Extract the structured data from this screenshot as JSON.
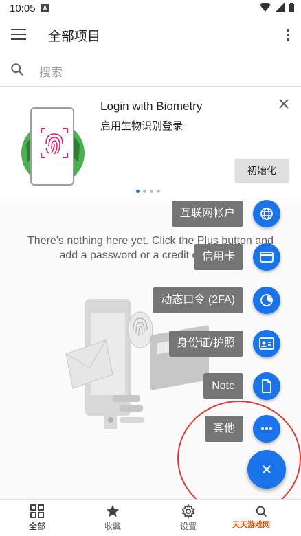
{
  "status_bar": {
    "time": "10:05",
    "notification_badge": "A"
  },
  "app_bar": {
    "title": "全部项目"
  },
  "search": {
    "placeholder": "搜索"
  },
  "promo": {
    "title": "Login with Biometry",
    "subtitle": "启用生物识别登录",
    "button_label": "初始化",
    "page_count": 4,
    "active_page": 1
  },
  "empty_state": {
    "line1": "There's nothing here yet. Click the Plus button and",
    "line2": "add a password or a credit card here."
  },
  "fab_menu": {
    "items": [
      {
        "label": "互联网帐户",
        "icon": "globe-icon"
      },
      {
        "label": "信用卡",
        "icon": "credit-card-icon"
      },
      {
        "label": "动态口令 (2FA)",
        "icon": "timer-icon"
      },
      {
        "label": "身份证/护照",
        "icon": "id-card-icon"
      },
      {
        "label": "Note",
        "icon": "note-icon"
      },
      {
        "label": "其他",
        "icon": "more-horizontal-icon"
      }
    ],
    "close_icon": "close-icon"
  },
  "bottom_nav": {
    "items": [
      {
        "label": "全部",
        "icon": "grid-icon"
      },
      {
        "label": "收藏",
        "icon": "star-icon"
      },
      {
        "label": "设置",
        "icon": "gear-icon"
      },
      {
        "label": "",
        "icon": "search-icon"
      }
    ]
  },
  "watermark": {
    "text": "天天游戏网"
  },
  "colors": {
    "accent": "#1a73e8",
    "chip_bg": "#757575",
    "highlight": "#e53935"
  }
}
